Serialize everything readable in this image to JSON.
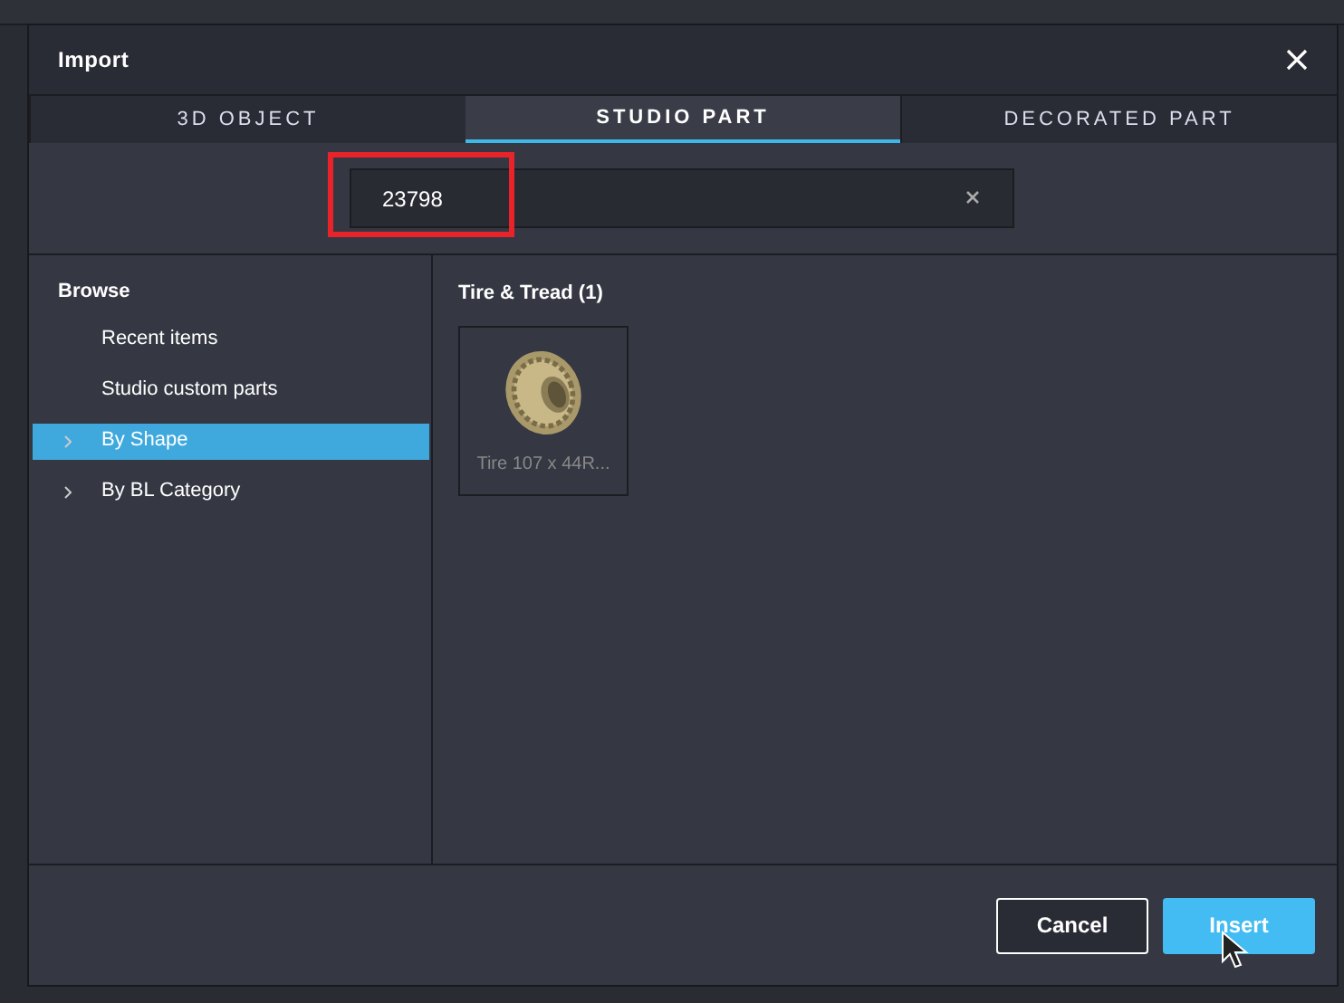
{
  "window": {
    "title": "Import"
  },
  "tabs": [
    {
      "label": "3D OBJECT",
      "selected": false
    },
    {
      "label": "STUDIO PART",
      "selected": true
    },
    {
      "label": "DECORATED PART",
      "selected": false
    }
  ],
  "search": {
    "value": "23798",
    "highlighted": true
  },
  "sidebar": {
    "heading": "Browse",
    "items": [
      {
        "label": "Recent items",
        "kind": "leaf",
        "selected": false
      },
      {
        "label": "Studio custom parts",
        "kind": "leaf",
        "selected": false
      },
      {
        "label": "By Shape",
        "kind": "group",
        "selected": true
      },
      {
        "label": "By BL Category",
        "kind": "group",
        "selected": false
      }
    ]
  },
  "results": {
    "heading": "Tire & Tread (1)",
    "items": [
      {
        "label": "Tire 107 x 44R..."
      }
    ]
  },
  "buttons": [
    {
      "label": "Cancel",
      "kind": "secondary"
    },
    {
      "label": "Insert",
      "kind": "primary"
    }
  ]
}
